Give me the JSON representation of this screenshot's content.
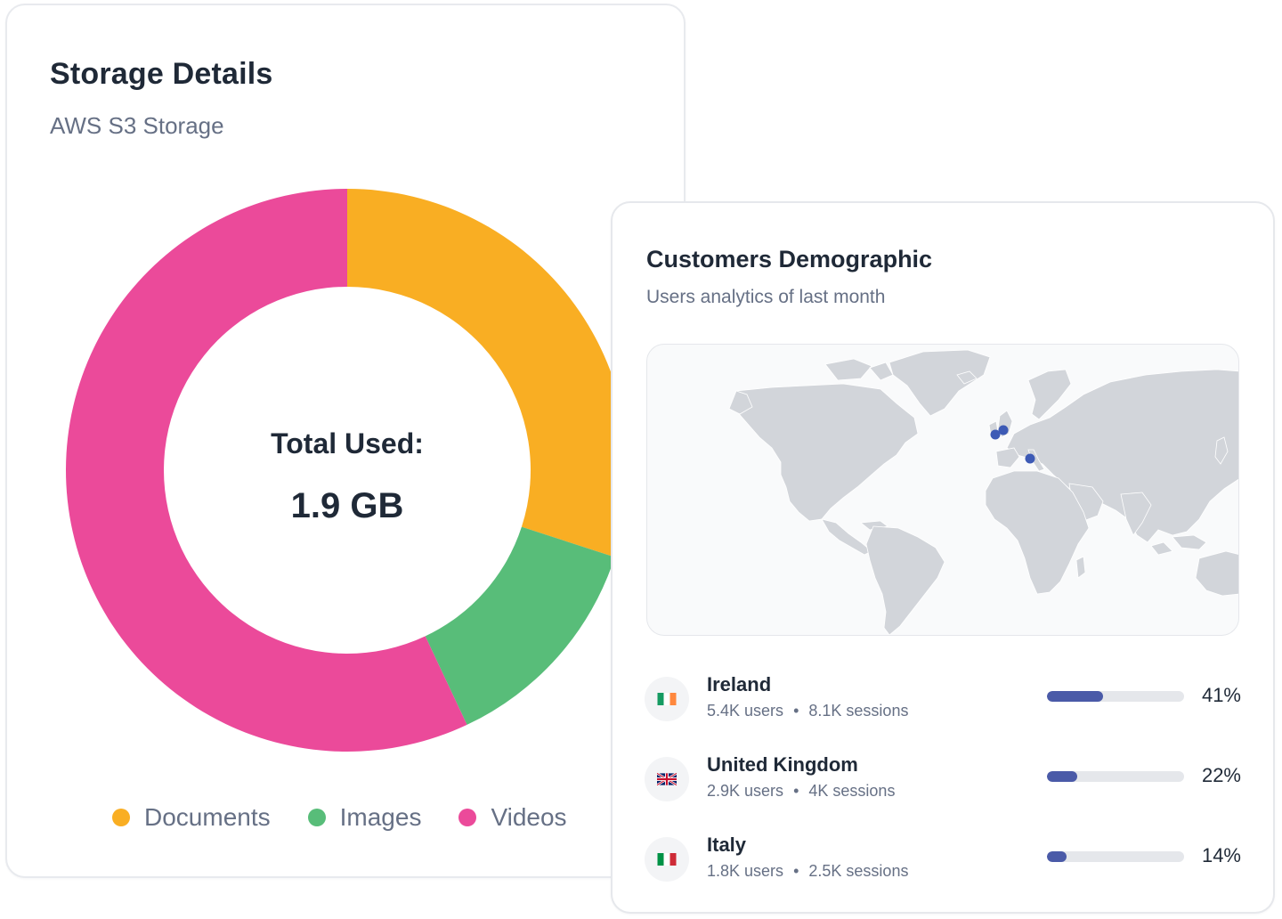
{
  "storage": {
    "title": "Storage Details",
    "subtitle": "AWS S3 Storage",
    "center_label": "Total Used:",
    "center_value": "1.9 GB"
  },
  "chart_data": {
    "type": "pie",
    "donut": true,
    "categories": [
      "Documents",
      "Images",
      "Videos"
    ],
    "values": [
      30,
      13,
      57
    ],
    "colors": [
      "#F9AE23",
      "#58BD79",
      "#EB4A9A"
    ],
    "legend_position": "bottom",
    "center_text": "Total Used:",
    "center_value": "1.9 GB"
  },
  "demographic": {
    "title": "Customers Demographic",
    "subtitle": "Users analytics of last month",
    "map": {
      "land_color": "#D2D5DA",
      "marker_color": "#3D5AB5",
      "markers": [
        "Ireland",
        "United Kingdom",
        "Italy"
      ]
    },
    "countries": [
      {
        "name": "Ireland",
        "users": "5.4K users",
        "sessions": "8.1K sessions",
        "percent_label": "41%",
        "percent": 41,
        "flag_icon": "ireland-flag-icon"
      },
      {
        "name": "United Kingdom",
        "users": "2.9K users",
        "sessions": "4K sessions",
        "percent_label": "22%",
        "percent": 22,
        "flag_icon": "uk-flag-icon"
      },
      {
        "name": "Italy",
        "users": "1.8K users",
        "sessions": "2.5K sessions",
        "percent_label": "14%",
        "percent": 14,
        "flag_icon": "italy-flag-icon"
      }
    ],
    "meta_separator": "•",
    "bar_color": "#4A5AA8",
    "track_color": "#E5E7EB"
  }
}
